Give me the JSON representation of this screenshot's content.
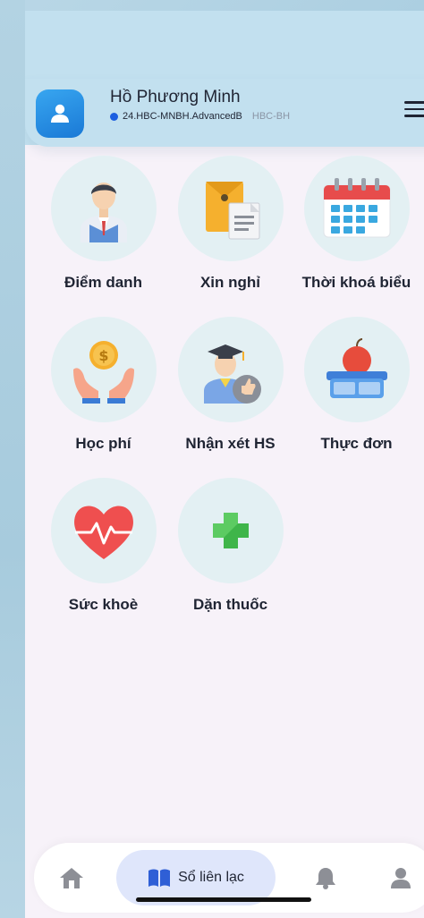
{
  "user": {
    "name": "Hồ Phương Minh",
    "class_code": "24.HBC-MNBH.AdvancedB",
    "school_code": "HBC-BH"
  },
  "colors": {
    "header_bg": "#c2e0ef",
    "accent_blue": "#1d5fe0",
    "tile_circle": "#e3f0f3",
    "active_nav_bg": "#dfe6fb"
  },
  "menu": {
    "items": [
      {
        "label": "Điểm danh",
        "icon": "student-attendance-icon"
      },
      {
        "label": "Xin nghỉ",
        "icon": "leave-request-document-icon"
      },
      {
        "label": "Thời khoá biểu",
        "icon": "calendar-schedule-icon"
      },
      {
        "label": "Học phí",
        "icon": "tuition-coin-hands-icon"
      },
      {
        "label": "Nhận xét HS",
        "icon": "graduate-thumbs-up-icon"
      },
      {
        "label": "Thực đơn",
        "icon": "lunchbox-apple-icon"
      },
      {
        "label": "Sức khoè",
        "icon": "heart-pulse-icon"
      },
      {
        "label": "Dặn thuốc",
        "icon": "medical-cross-icon"
      }
    ]
  },
  "bottom_nav": {
    "items": [
      {
        "name": "home",
        "icon": "home-icon"
      },
      {
        "name": "contact-book",
        "label": "Sổ liên lạc",
        "icon": "open-book-icon",
        "active": true
      },
      {
        "name": "notifications",
        "icon": "bell-icon"
      },
      {
        "name": "profile",
        "icon": "person-icon"
      }
    ]
  }
}
